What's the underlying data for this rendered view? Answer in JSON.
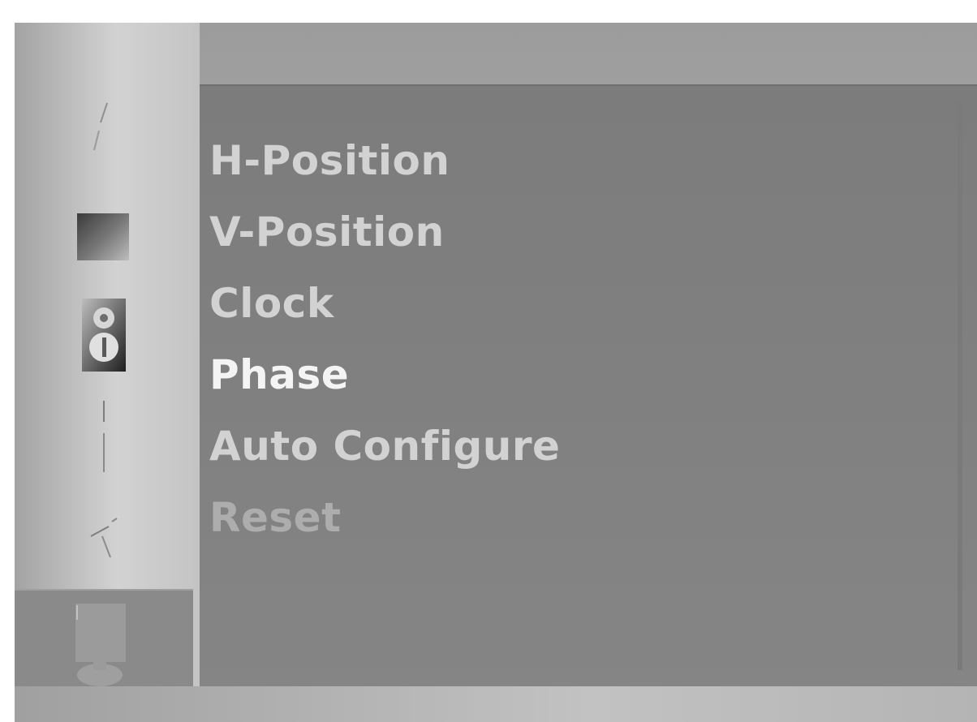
{
  "sidebar": {
    "items": [
      {
        "icon": "picture-icon"
      },
      {
        "icon": "color-icon"
      },
      {
        "icon": "speaker-icon"
      },
      {
        "icon": "position-icon"
      },
      {
        "icon": "setup-icon"
      },
      {
        "icon": "monitor-icon",
        "selected": true
      }
    ]
  },
  "menu": {
    "items": [
      {
        "label": "H-Position"
      },
      {
        "label": "V-Position"
      },
      {
        "label": "Clock"
      },
      {
        "label": "Phase"
      },
      {
        "label": "Auto Configure"
      },
      {
        "label": "Reset"
      }
    ]
  }
}
